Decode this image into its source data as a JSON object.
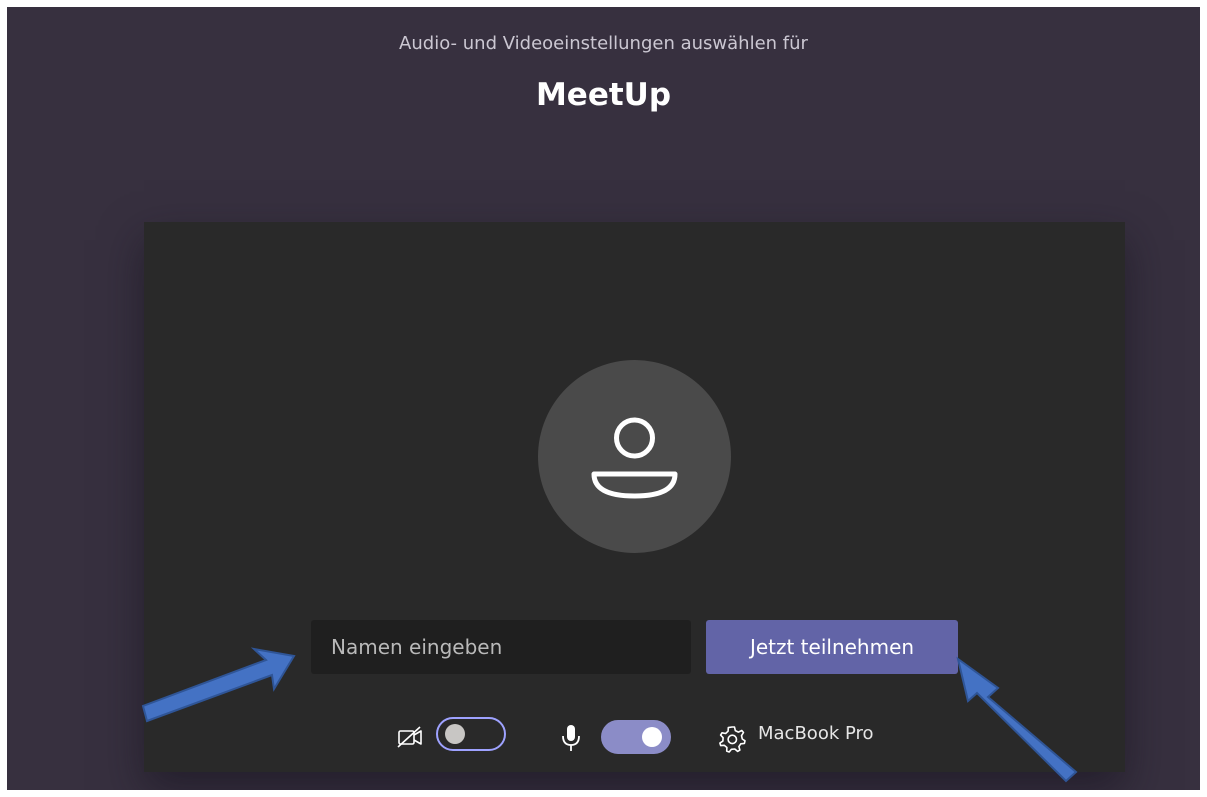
{
  "header": {
    "subtitle": "Audio- und Videoeinstellungen auswählen für",
    "title": "MeetUp"
  },
  "join_form": {
    "name_placeholder": "Namen eingeben",
    "join_label": "Jetzt teilnehmen"
  },
  "controls": {
    "camera": {
      "icon": "camera-off-icon",
      "enabled": false
    },
    "microphone": {
      "icon": "microphone-icon",
      "enabled": true
    },
    "device": {
      "icon": "gear-icon",
      "label": "MacBook Pro"
    }
  },
  "colors": {
    "page_background": "#37303f",
    "preview_background": "#292929",
    "avatar_background": "#4a4a4a",
    "accent": "#6264a7",
    "annotation_arrow": "#4472c4"
  }
}
